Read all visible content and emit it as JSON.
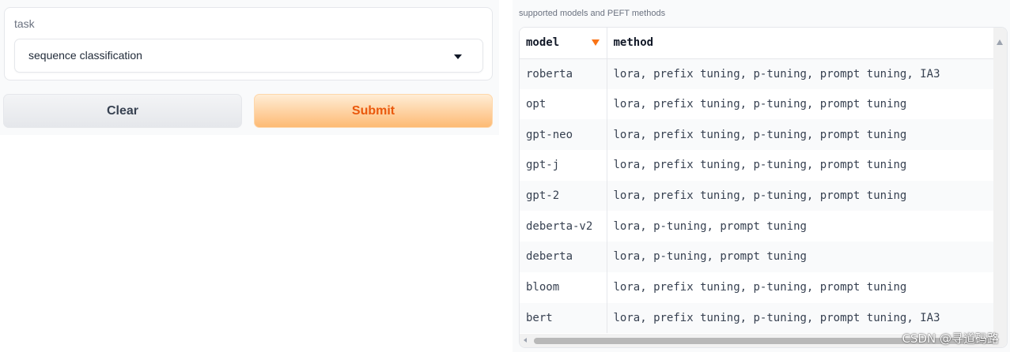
{
  "task": {
    "label": "task",
    "selected_value": "sequence classification"
  },
  "buttons": {
    "clear_label": "Clear",
    "submit_label": "Submit"
  },
  "dataframe": {
    "label": "supported models and PEFT methods",
    "headers": [
      "model",
      "method"
    ],
    "rows": [
      [
        "roberta",
        "lora, prefix tuning, p-tuning, prompt tuning, IA3"
      ],
      [
        "opt",
        "lora, prefix tuning, p-tuning, prompt tuning"
      ],
      [
        "gpt-neo",
        "lora, prefix tuning, p-tuning, prompt tuning"
      ],
      [
        "gpt-j",
        "lora, prefix tuning, p-tuning, prompt tuning"
      ],
      [
        "gpt-2",
        "lora, prefix tuning, p-tuning, prompt tuning"
      ],
      [
        "deberta-v2",
        "lora, p-tuning, prompt tuning"
      ],
      [
        "deberta",
        "lora, p-tuning, prompt tuning"
      ],
      [
        "bloom",
        "lora, prefix tuning, p-tuning, prompt tuning"
      ],
      [
        "bert",
        "lora, prefix tuning, p-tuning, prompt tuning, IA3"
      ]
    ]
  },
  "watermark": "CSDN @寻道码路",
  "colors": {
    "accent": "#f97316",
    "submit_text": "#ea580c"
  }
}
